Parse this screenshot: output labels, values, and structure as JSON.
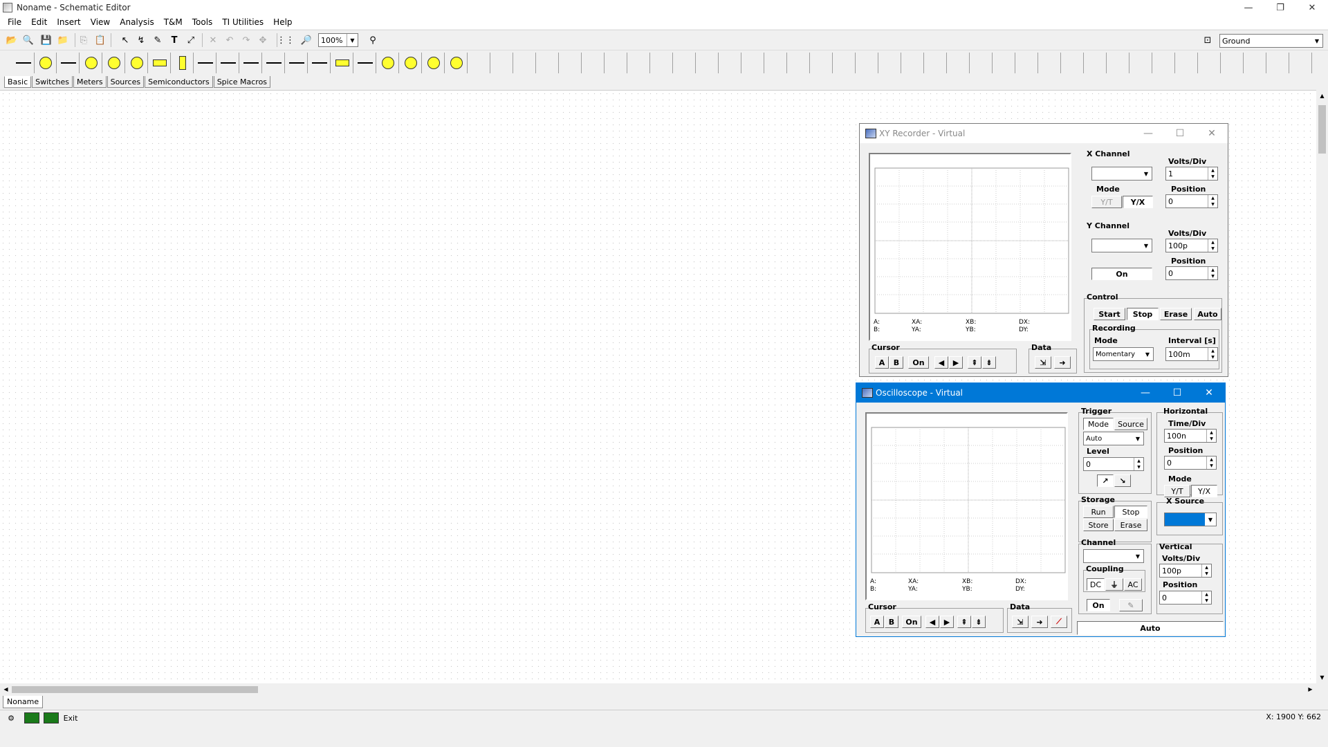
{
  "window": {
    "title": "Noname - Schematic Editor",
    "min": "—",
    "max": "❐",
    "close": "✕"
  },
  "menu": [
    "File",
    "Edit",
    "Insert",
    "View",
    "Analysis",
    "T&M",
    "Tools",
    "TI Utilities",
    "Help"
  ],
  "toolbar": {
    "zoom": "100%",
    "ground_select": "Ground"
  },
  "palette_tabs": [
    "Basic",
    "Switches",
    "Meters",
    "Sources",
    "Semiconductors",
    "Spice Macros"
  ],
  "doc_tab": "Noname",
  "status": {
    "exit": "Exit",
    "coords": "X: 1900 Y: 662"
  },
  "xy_recorder": {
    "title": "XY Recorder - Virtual",
    "readout": {
      "a": "A:",
      "b": "B:",
      "xa": "XA:",
      "ya": "YA:",
      "xb": "XB:",
      "yb": "YB:",
      "dx": "DX:",
      "dy": "DY:"
    },
    "x_channel": {
      "label": "X Channel",
      "volts_div_label": "Volts/Div",
      "volts_div": "1",
      "mode_label": "Mode",
      "mode_yt": "Y/T",
      "mode_yx": "Y/X",
      "position_label": "Position",
      "position": "0"
    },
    "y_channel": {
      "label": "Y Channel",
      "volts_div_label": "Volts/Div",
      "volts_div": "100p",
      "on": "On",
      "position_label": "Position",
      "position": "0"
    },
    "control": {
      "label": "Control",
      "start": "Start",
      "stop": "Stop",
      "erase": "Erase",
      "auto": "Auto"
    },
    "recording": {
      "label": "Recording",
      "mode_label": "Mode",
      "mode": "Momentary",
      "interval_label": "Interval [s]",
      "interval": "100m"
    },
    "cursor": {
      "label": "Cursor",
      "a": "A",
      "b": "B",
      "on": "On"
    },
    "data": {
      "label": "Data"
    }
  },
  "oscilloscope": {
    "title": "Oscilloscope - Virtual",
    "readout": {
      "a": "A:",
      "b": "B:",
      "xa": "XA:",
      "ya": "YA:",
      "xb": "XB:",
      "yb": "YB:",
      "dx": "DX:",
      "dy": "DY:"
    },
    "trigger": {
      "label": "Trigger",
      "mode": "Mode",
      "source": "Source",
      "value": "Auto",
      "level_label": "Level",
      "level": "0"
    },
    "storage": {
      "label": "Storage",
      "run": "Run",
      "stop": "Stop",
      "store": "Store",
      "erase": "Erase"
    },
    "channel": {
      "label": "Channel",
      "coupling_label": "Coupling",
      "dc": "DC",
      "ac": "AC",
      "on": "On"
    },
    "horizontal": {
      "label": "Horizontal",
      "time_div_label": "Time/Div",
      "time_div": "100n",
      "position_label": "Position",
      "position": "0",
      "mode_label": "Mode",
      "mode_yt": "Y/T",
      "mode_yx": "Y/X",
      "x_source_label": "X Source"
    },
    "vertical": {
      "label": "Vertical",
      "volts_div_label": "Volts/Div",
      "volts_div": "100p",
      "position_label": "Position",
      "position": "0"
    },
    "cursor": {
      "label": "Cursor",
      "a": "A",
      "b": "B",
      "on": "On"
    },
    "data": {
      "label": "Data"
    },
    "auto": "Auto"
  }
}
